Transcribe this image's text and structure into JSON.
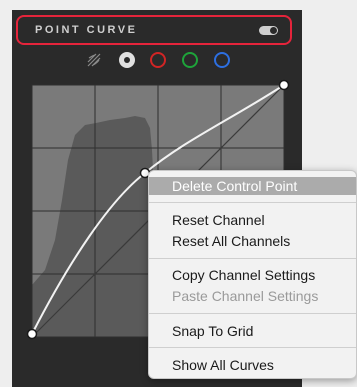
{
  "panel": {
    "title": "POINT CURVE",
    "toggle_on": true
  },
  "channels": [
    {
      "name": "luminance",
      "icon": "luminance-icon"
    },
    {
      "name": "rgb",
      "icon": "rgb-channel-icon",
      "selected": true
    },
    {
      "name": "red",
      "color": "#d12525"
    },
    {
      "name": "green",
      "color": "#1ea33a"
    },
    {
      "name": "blue",
      "color": "#2d6fe0"
    }
  ],
  "context_menu": {
    "delete_control_point": "Delete Control Point",
    "reset_channel": "Reset Channel",
    "reset_all_channels": "Reset All Channels",
    "copy_channel_settings": "Copy Channel Settings",
    "paste_channel_settings": "Paste Channel Settings",
    "snap_to_grid": "Snap To Grid",
    "show_all_curves": "Show All Curves"
  },
  "colors": {
    "panel_bg": "#2a2a2a",
    "highlight_border": "#e5243b",
    "menu_bg": "#f2f2f2",
    "menu_highlight": "#ababab"
  }
}
